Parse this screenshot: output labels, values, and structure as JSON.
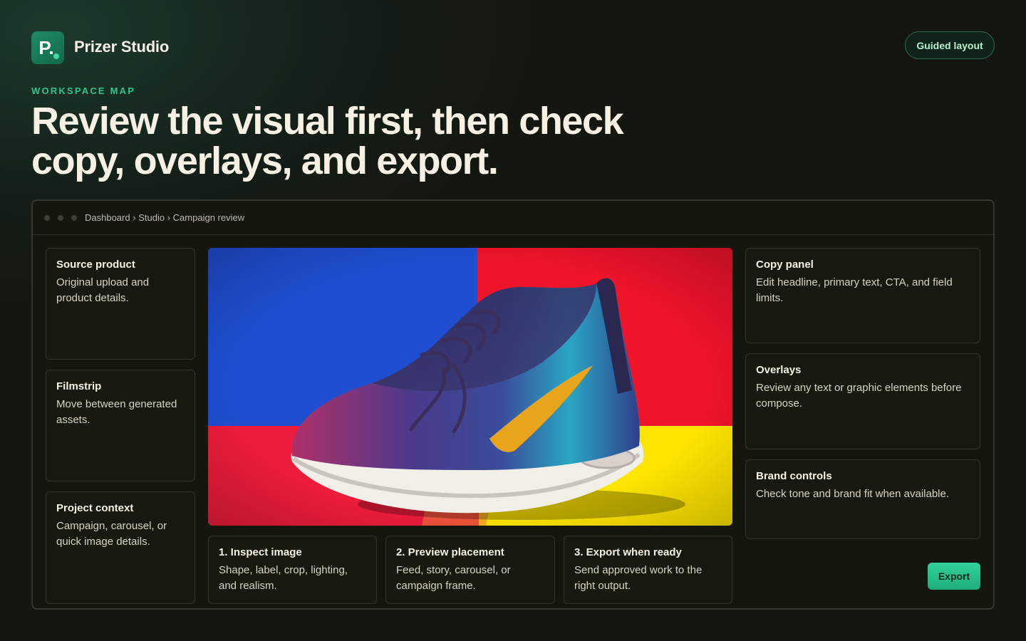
{
  "brand": {
    "logo_letter": "P.",
    "name": "Prizer Studio"
  },
  "header": {
    "guided_label": "Guided layout"
  },
  "intro": {
    "eyebrow": "WORKSPACE MAP",
    "headline": "Review the visual first, then check copy, overlays, and export."
  },
  "window": {
    "breadcrumb": [
      "Dashboard",
      "Studio",
      "Campaign review"
    ],
    "breadcrumb_separator": "›"
  },
  "left_cards": [
    {
      "title": "Source product",
      "desc": "Original upload and product details."
    },
    {
      "title": "Filmstrip",
      "desc": "Move between generated assets."
    },
    {
      "title": "Project context",
      "desc": "Campaign, carousel, or quick image details."
    }
  ],
  "steps": [
    {
      "title": "1. Inspect image",
      "desc": "Shape, label, crop, lighting, and realism."
    },
    {
      "title": "2. Preview placement",
      "desc": "Feed, story, carousel, or campaign frame."
    },
    {
      "title": "3. Export when ready",
      "desc": "Send approved work to the right output."
    }
  ],
  "right_cards": [
    {
      "title": "Copy panel",
      "desc": "Edit headline, primary text, CTA, and field limits."
    },
    {
      "title": "Overlays",
      "desc": "Review any text or graphic elements before compose."
    },
    {
      "title": "Brand controls",
      "desc": "Check tone and brand fit when available."
    }
  ],
  "actions": {
    "export_label": "Export"
  },
  "colors": {
    "accent": "#2fc58a",
    "background": "#14170f",
    "hero_blue": "#1f4ed1",
    "hero_red": "#f0142a",
    "hero_yellow": "#ffe600"
  }
}
